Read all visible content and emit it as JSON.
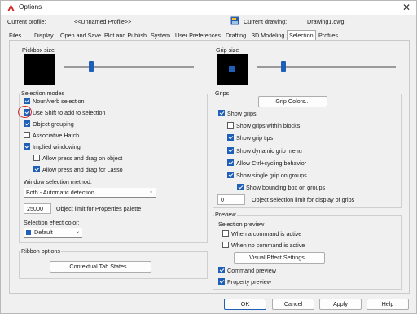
{
  "window": {
    "title": "Options",
    "close_glyph": "✕",
    "accent_color": "#1f5fb8",
    "logo_color": "#d22525"
  },
  "profile": {
    "current_profile_label": "Current profile:",
    "current_profile_value": "<<Unnamed Profile>>",
    "current_drawing_label": "Current drawing:",
    "current_drawing_value": "Drawing1.dwg"
  },
  "tabs": [
    "Files",
    "Display",
    "Open and Save",
    "Plot and Publish",
    "System",
    "User Preferences",
    "Drafting",
    "3D Modeling",
    "Selection",
    "Profiles"
  ],
  "active_tab": "Selection",
  "pickbox": {
    "title": "Pickbox size"
  },
  "grip_size": {
    "title": "Grip size"
  },
  "selection_modes": {
    "title": "Selection modes",
    "noun_verb": {
      "label": "Noun/verb selection",
      "checked": true
    },
    "shift_add": {
      "label": "Use Shift to add to selection",
      "checked": true
    },
    "object_grouping": {
      "label": "Object grouping",
      "checked": true
    },
    "associative_hatch": {
      "label": "Associative Hatch",
      "checked": false
    },
    "implied_windowing": {
      "label": "Implied windowing",
      "checked": true
    },
    "press_drag_object": {
      "label": "Allow press and drag on object",
      "checked": false
    },
    "press_drag_lasso": {
      "label": "Allow press and drag for Lasso",
      "checked": true
    },
    "window_method_label": "Window selection method:",
    "window_method_value": "Both - Automatic detection",
    "object_limit_value": "25000",
    "object_limit_label": "Object limit for Properties palette",
    "effect_color_label": "Selection effect color:",
    "effect_color_value": "Default"
  },
  "ribbon": {
    "title": "Ribbon options",
    "contextual_button": "Contextual Tab States..."
  },
  "grips": {
    "title": "Grips",
    "grip_colors_button": "Grip Colors...",
    "show_grips": {
      "label": "Show grips",
      "checked": true
    },
    "within_blocks": {
      "label": "Show grips within blocks",
      "checked": false
    },
    "grip_tips": {
      "label": "Show grip tips",
      "checked": true
    },
    "dynamic_menu": {
      "label": "Show dynamic grip menu",
      "checked": true
    },
    "ctrl_cycling": {
      "label": "Allow Ctrl+cycling behavior",
      "checked": true
    },
    "single_grip": {
      "label": "Show single grip on groups",
      "checked": true
    },
    "bounding_box": {
      "label": "Show bounding box on groups",
      "checked": true
    },
    "limit_value": "0",
    "limit_label": "Object selection limit for display of grips"
  },
  "preview": {
    "title": "Preview",
    "subtitle": "Selection preview",
    "command_active": {
      "label": "When a command is active",
      "checked": false
    },
    "no_command": {
      "label": "When no command is active",
      "checked": false
    },
    "visual_effect_button": "Visual Effect Settings...",
    "command_preview": {
      "label": "Command preview",
      "checked": true
    },
    "property_preview": {
      "label": "Property preview",
      "checked": true
    }
  },
  "footer": {
    "ok": "OK",
    "cancel": "Cancel",
    "apply": "Apply",
    "help": "Help"
  }
}
